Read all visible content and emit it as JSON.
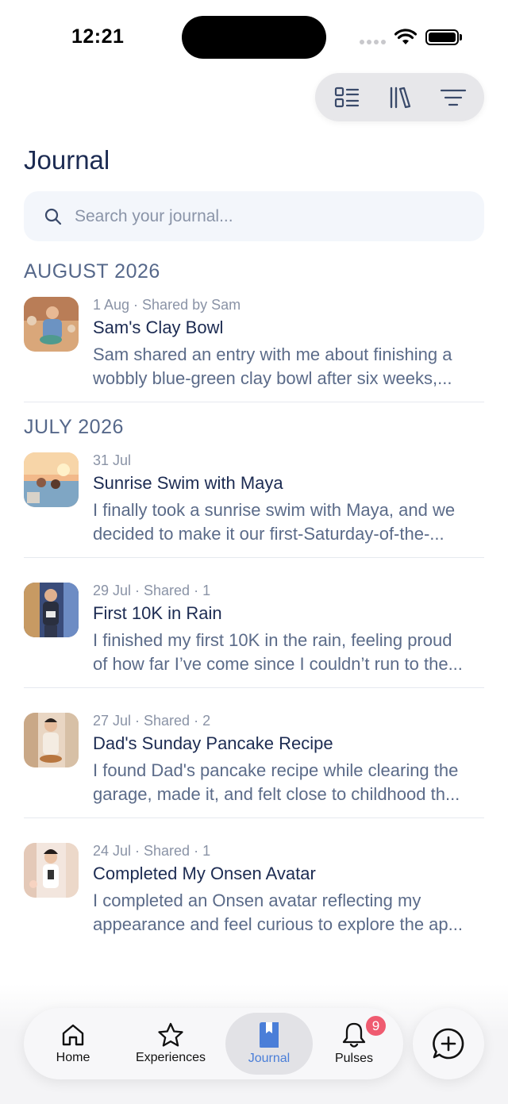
{
  "status_bar": {
    "time": "12:21"
  },
  "toolbar": {
    "icons": [
      "list-view-icon",
      "library-icon",
      "filter-icon"
    ]
  },
  "page": {
    "title": "Journal"
  },
  "search": {
    "placeholder": "Search your journal..."
  },
  "sections": [
    {
      "month": "AUGUST 2026",
      "entries": [
        {
          "meta": "1 Aug · Shared by Sam",
          "title": "Sam's Clay Bowl",
          "excerpt_line1": "Sam shared an entry with me about finishing a",
          "excerpt_line2": "wobbly blue-green clay bowl after six weeks,..."
        }
      ]
    },
    {
      "month": "JULY 2026",
      "entries": [
        {
          "meta": "31 Jul",
          "title": "Sunrise Swim with Maya",
          "excerpt_line1": "I finally took a sunrise swim with Maya, and we",
          "excerpt_line2": "decided to make it our first-Saturday-of-the-..."
        },
        {
          "meta": "29 Jul · Shared · 1",
          "title": "First 10K in Rain",
          "excerpt_line1": "I finished my first 10K in the rain, feeling proud",
          "excerpt_line2": "of how far I’ve come since I couldn’t run to the..."
        },
        {
          "meta": "27 Jul · Shared · 2",
          "title": "Dad's Sunday Pancake Recipe",
          "excerpt_line1": "I found Dad's pancake recipe while clearing the",
          "excerpt_line2": "garage, made it, and felt close to childhood th..."
        },
        {
          "meta": "24 Jul · Shared · 1",
          "title": "Completed My Onsen Avatar",
          "excerpt_line1": "I completed an Onsen avatar reflecting my",
          "excerpt_line2": "appearance and feel curious to explore the ap..."
        }
      ]
    }
  ],
  "tab_bar": {
    "tabs": [
      {
        "label": "Home",
        "icon": "home-icon"
      },
      {
        "label": "Experiences",
        "icon": "star-icon"
      },
      {
        "label": "Journal",
        "icon": "journal-book-icon",
        "active": true
      },
      {
        "label": "Pulses",
        "icon": "bell-icon"
      }
    ],
    "pulses_badge": "9"
  },
  "fab": {
    "icon": "add-chat-icon"
  },
  "colors": {
    "accent": "#4a7ed8",
    "title": "#1c2b52",
    "badge": "#ef5b70"
  }
}
